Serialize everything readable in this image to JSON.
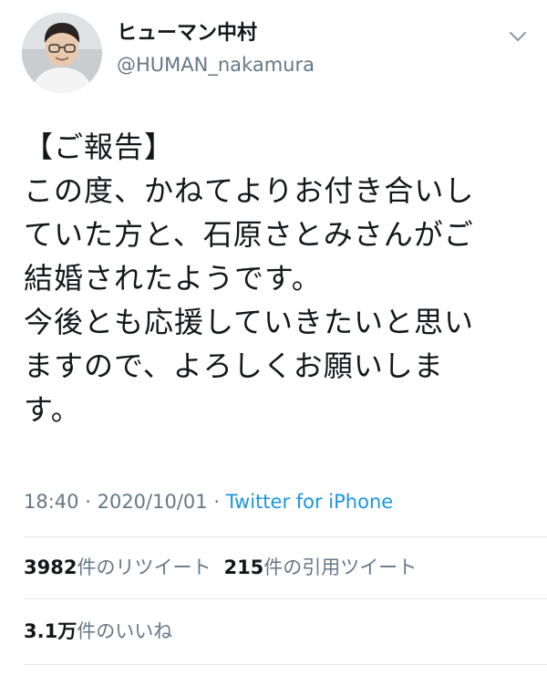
{
  "author": {
    "display_name": "ヒューマン中村",
    "handle": "@HUMAN_nakamura",
    "avatar_icon": "user-avatar-photo"
  },
  "menu_icon": "chevron-down-icon",
  "tweet": {
    "lines": [
      "【ご報告】",
      "この度、かねてよりお付き合いし",
      "ていた方と、石原さとみさんがご",
      "結婚されたようです。",
      "今後とも応援していきたいと思い",
      "ますので、よろしくお願いしま",
      "す。"
    ]
  },
  "meta": {
    "time": "18:40",
    "separator": "·",
    "date": "2020/10/01",
    "source": "Twitter for iPhone"
  },
  "stats": {
    "retweets_count": "3982",
    "retweets_label": "件のリツイート",
    "quotes_count": "215",
    "quotes_label": "件の引用ツイート",
    "likes_count": "3.1万",
    "likes_label": "件のいいね"
  },
  "colors": {
    "text": "#14171a",
    "secondary": "#657786",
    "link": "#1b95e0",
    "divider": "#e1e8ed"
  }
}
